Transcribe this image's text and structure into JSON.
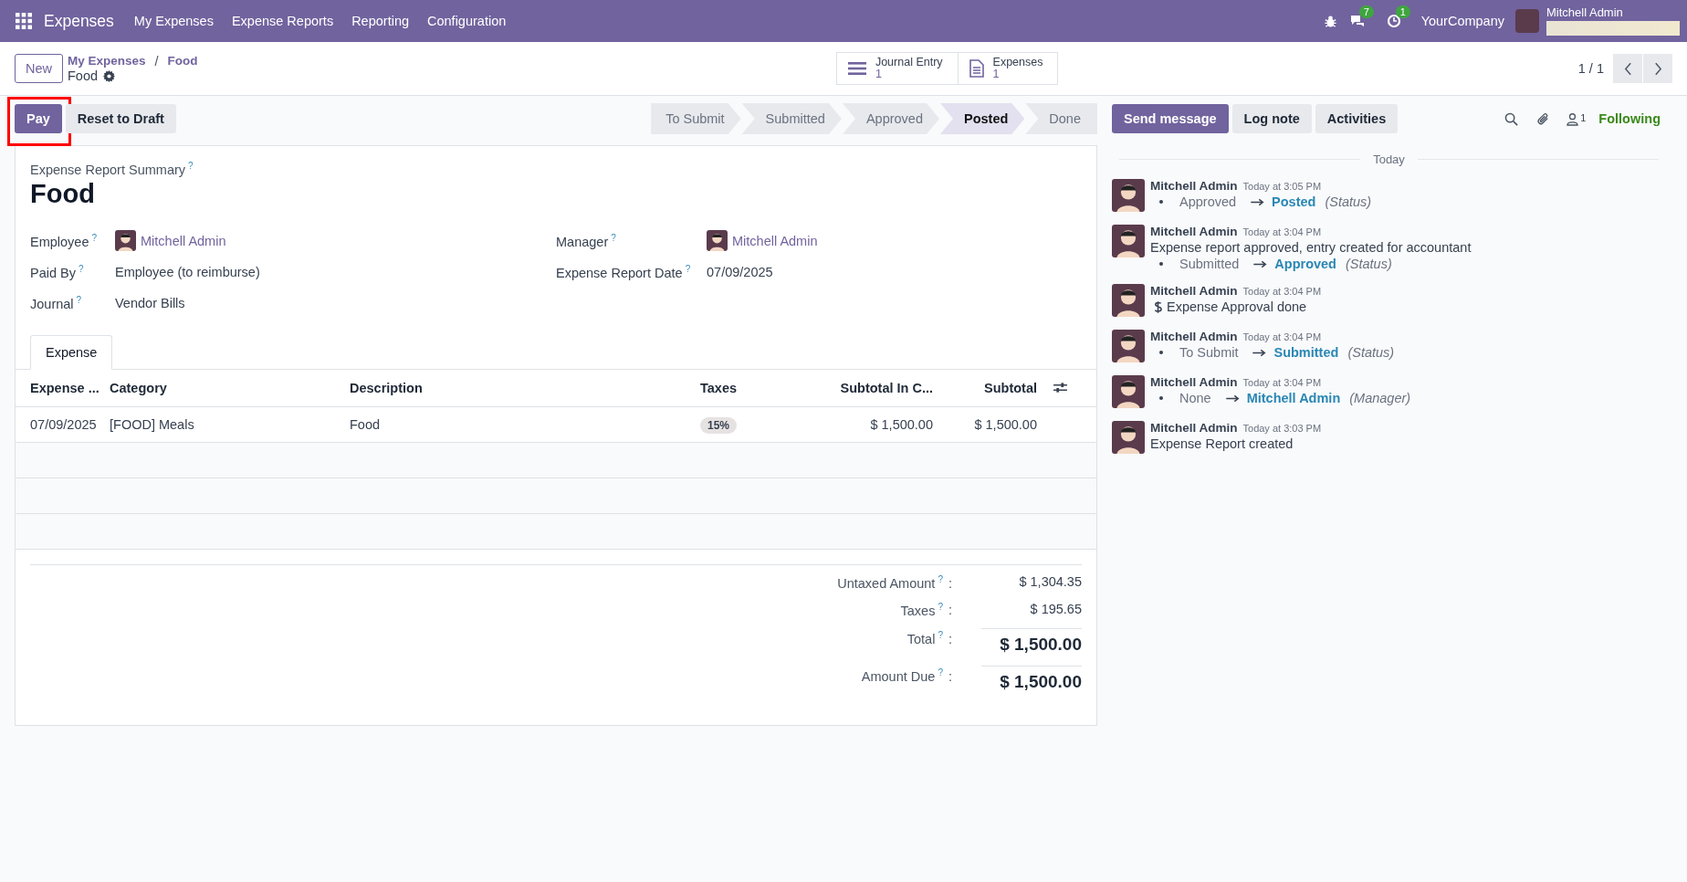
{
  "navbar": {
    "app_name": "Expenses",
    "menu": [
      "My Expenses",
      "Expense Reports",
      "Reporting",
      "Configuration"
    ],
    "messages_count": "7",
    "activities_count": "1",
    "company": "YourCompany",
    "user": "Mitchell Admin"
  },
  "control_panel": {
    "new_button": "New",
    "breadcrumb_parent": "My Expenses",
    "breadcrumb_separator": "/",
    "breadcrumb_current": "Food",
    "record_name": "Food",
    "smart_buttons": [
      {
        "kind": "list",
        "label": "Journal Entry",
        "count": "1"
      },
      {
        "kind": "document",
        "label": "Expenses",
        "count": "1"
      }
    ],
    "pager": "1 / 1"
  },
  "actions": [
    {
      "label": "Pay",
      "primary": true,
      "highlighted": true
    },
    {
      "label": "Reset to Draft",
      "primary": false,
      "highlighted": false
    }
  ],
  "stages": [
    {
      "label": "To Submit",
      "selected": false
    },
    {
      "label": "Submitted",
      "selected": false
    },
    {
      "label": "Approved",
      "selected": false
    },
    {
      "label": "Posted",
      "selected": true
    },
    {
      "label": "Done",
      "selected": false
    }
  ],
  "form": {
    "summary_label": "Expense Report Summary",
    "summary_help": "?",
    "title": "Food",
    "left_fields": [
      {
        "label": "Employee",
        "help": "?",
        "value": "Mitchell Admin",
        "kind": "user"
      },
      {
        "label": "Paid By",
        "help": "?",
        "value": "Employee (to reimburse)",
        "kind": "text"
      },
      {
        "label": "Journal",
        "help": "?",
        "value": "Vendor Bills",
        "kind": "text"
      }
    ],
    "right_fields": [
      {
        "label": "Manager",
        "help": "?",
        "value": "Mitchell Admin",
        "kind": "user"
      },
      {
        "label": "Expense Report Date",
        "help": "?",
        "value": "07/09/2025",
        "kind": "text"
      }
    ],
    "tabs": [
      {
        "label": "Expense",
        "selected": true
      }
    ],
    "table": {
      "columns": [
        {
          "label": "Expense ..."
        },
        {
          "label": "Category"
        },
        {
          "label": "Description"
        },
        {
          "label": "Taxes"
        },
        {
          "label": "Subtotal In C..."
        },
        {
          "label": "Subtotal"
        }
      ],
      "rows": [
        {
          "date": "07/09/2025",
          "category": "[FOOD] Meals",
          "description": "Food",
          "taxes": "15%",
          "subtotal_company": "$ 1,500.00",
          "subtotal": "$ 1,500.00"
        }
      ]
    },
    "totals": [
      {
        "label": "Untaxed Amount",
        "help": "?",
        "separator": ":",
        "value": "$ 1,304.35",
        "kind": "normal"
      },
      {
        "label": "Taxes",
        "help": "?",
        "separator": ":",
        "value": "$ 195.65",
        "kind": "normal"
      },
      {
        "label": "Total",
        "help": "?",
        "separator": ":",
        "value": "$ 1,500.00",
        "kind": "grand"
      },
      {
        "label": "Amount Due",
        "help": "?",
        "separator": ":",
        "value": "$ 1,500.00",
        "kind": "grand"
      }
    ]
  },
  "chatter": {
    "buttons": [
      {
        "label": "Send message",
        "primary": true
      },
      {
        "label": "Log note",
        "primary": false
      },
      {
        "label": "Activities",
        "primary": false
      }
    ],
    "followers_count": "1",
    "following": "Following",
    "date_separator": "Today",
    "messages": [
      {
        "author": "Mitchell Admin",
        "time": "Today at 3:05 PM",
        "kind": "tracking",
        "old": "Approved",
        "new": "Posted",
        "field": "(Status)"
      },
      {
        "author": "Mitchell Admin",
        "time": "Today at 3:04 PM",
        "kind": "body_tracking",
        "body": "Expense report approved, entry created for accountant",
        "old": "Submitted",
        "new": "Approved",
        "field": "(Status)"
      },
      {
        "author": "Mitchell Admin",
        "time": "Today at 3:04 PM",
        "kind": "activity",
        "body": "Expense Approval done"
      },
      {
        "author": "Mitchell Admin",
        "time": "Today at 3:04 PM",
        "kind": "tracking",
        "old": "To Submit",
        "new": "Submitted",
        "field": "(Status)"
      },
      {
        "author": "Mitchell Admin",
        "time": "Today at 3:04 PM",
        "kind": "tracking",
        "old": "None",
        "new": "Mitchell Admin",
        "field": "(Manager)"
      },
      {
        "author": "Mitchell Admin",
        "time": "Today at 3:03 PM",
        "kind": "body",
        "body": "Expense Report created"
      }
    ]
  }
}
